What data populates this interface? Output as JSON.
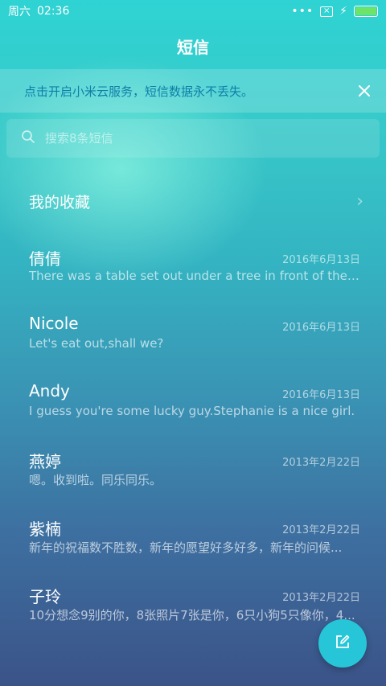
{
  "status": {
    "day": "周六",
    "time": "02:36",
    "dots": "•••",
    "battery_level": 1.0,
    "battery_color": "#6de36a"
  },
  "header": {
    "title": "短信"
  },
  "banner": {
    "text": "点击开启小米云服务，短信数据永不丢失。",
    "close_glyph": "✕"
  },
  "search": {
    "placeholder": "搜索8条短信"
  },
  "favorites": {
    "label": "我的收藏",
    "chevron": "›"
  },
  "messages": [
    {
      "name": "倩倩",
      "date": "2016年6月13日",
      "preview": "There was a table set out under a tree in front of the ho..."
    },
    {
      "name": "Nicole",
      "date": "2016年6月13日",
      "preview": "Let's eat out,shall we?"
    },
    {
      "name": "Andy",
      "date": "2016年6月13日",
      "preview": "I guess you're some lucky guy.Stephanie is a nice girl."
    },
    {
      "name": "燕婷",
      "date": "2013年2月22日",
      "preview": "嗯。收到啦。同乐同乐。"
    },
    {
      "name": "紫楠",
      "date": "2013年2月22日",
      "preview": "新年的祝福数不胜数，新年的愿望好多好多，新年的问候..."
    },
    {
      "name": "子玲",
      "date": "2013年2月22日",
      "preview": "10分想念9别的你，8张照片7张是你，6只小狗5只像你，4..."
    }
  ],
  "colors": {
    "accent": "#26c6d8",
    "banner_text": "#0e7fa8"
  },
  "icons": {
    "search": "search-icon",
    "close": "close-icon",
    "chevron": "chevron-right-icon",
    "compose": "compose-icon"
  }
}
